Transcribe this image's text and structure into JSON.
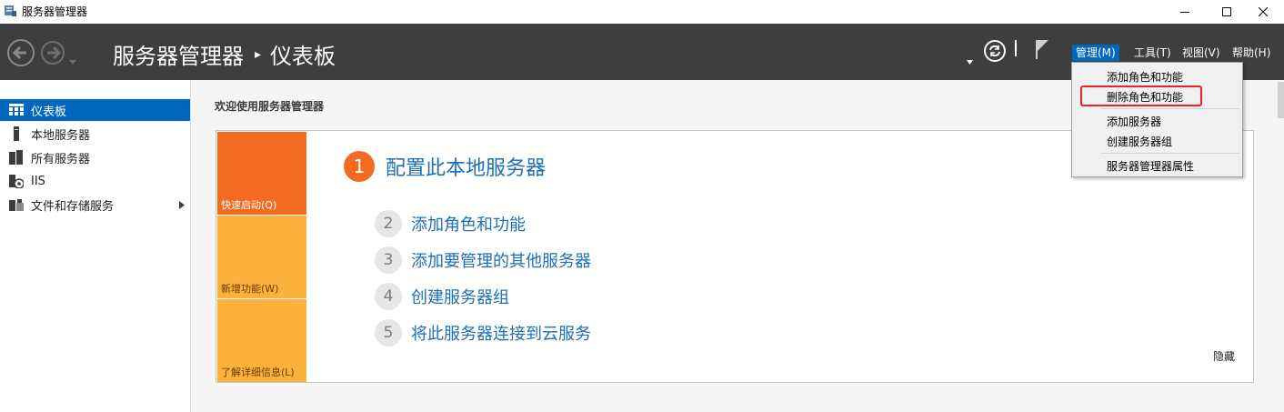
{
  "window": {
    "title": "服务器管理器",
    "icon": "server-manager-icon"
  },
  "header": {
    "breadcrumb_root": "服务器管理器",
    "breadcrumb_separator": "▸",
    "breadcrumb_current": "仪表板",
    "menus": [
      {
        "label": "管理(M)",
        "active": true
      },
      {
        "label": "工具(T)",
        "active": false
      },
      {
        "label": "视图(V)",
        "active": false
      },
      {
        "label": "帮助(H)",
        "active": false
      }
    ]
  },
  "sidebar": {
    "items": [
      {
        "label": "仪表板",
        "icon": "dashboard-icon",
        "selected": true
      },
      {
        "label": "本地服务器",
        "icon": "local-server-icon",
        "selected": false
      },
      {
        "label": "所有服务器",
        "icon": "all-servers-icon",
        "selected": false
      },
      {
        "label": "IIS",
        "icon": "iis-icon",
        "selected": false
      },
      {
        "label": "文件和存储服务",
        "icon": "file-storage-icon",
        "selected": false,
        "has_submenu": true
      }
    ]
  },
  "main": {
    "welcome_title": "欢迎使用服务器管理器",
    "tiles": [
      {
        "label": "快速启动(Q)"
      },
      {
        "label": "新增功能(W)"
      },
      {
        "label": "了解详细信息(L)"
      }
    ],
    "steps": [
      {
        "number": "1",
        "label": "配置此本地服务器"
      },
      {
        "number": "2",
        "label": "添加角色和功能"
      },
      {
        "number": "3",
        "label": "添加要管理的其他服务器"
      },
      {
        "number": "4",
        "label": "创建服务器组"
      },
      {
        "number": "5",
        "label": "将此服务器连接到云服务"
      }
    ],
    "hide_label": "隐藏"
  },
  "manage_menu": {
    "items": [
      {
        "label": "添加角色和功能"
      },
      {
        "label": "删除角色和功能",
        "highlighted": true
      },
      {
        "label": "添加服务器"
      },
      {
        "label": "创建服务器组"
      },
      {
        "label": "服务器管理器属性"
      }
    ]
  },
  "colors": {
    "header_bg": "#3e3e3e",
    "accent": "#0067c0",
    "quick_start_tile": "#f36b21",
    "secondary_tile": "#fbb13c",
    "link": "#1f6fb5",
    "highlight_border": "#e8232a"
  }
}
